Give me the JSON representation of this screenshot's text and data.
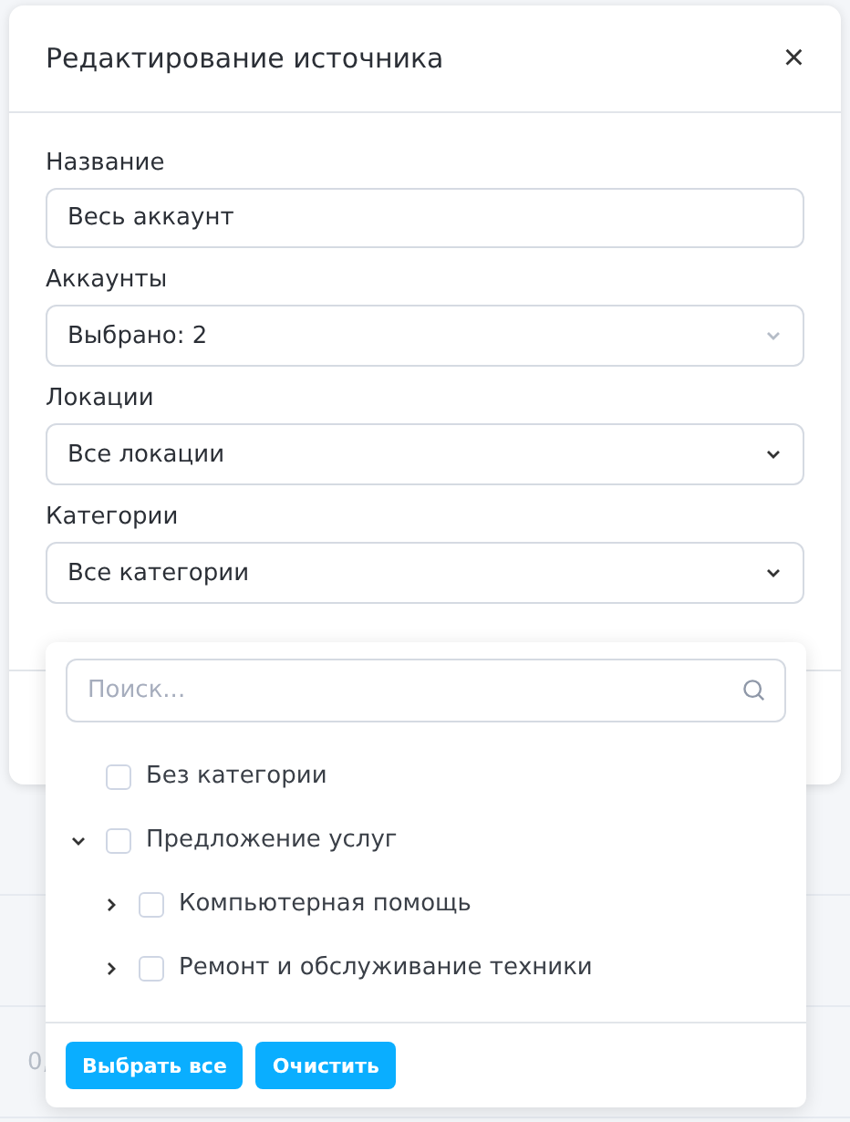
{
  "background": {
    "cell_text": "0,"
  },
  "dialog": {
    "title": "Редактирование источника",
    "close": "×"
  },
  "fields": [
    {
      "kind": "text",
      "label": "Название",
      "value": "Весь аккаунт"
    },
    {
      "kind": "select",
      "label": "Аккаунты",
      "value": "Выбрано: 2",
      "disabled": true
    },
    {
      "kind": "select",
      "label": "Локации",
      "value": "Все локации",
      "disabled": false
    },
    {
      "kind": "select",
      "label": "Категории",
      "value": "Все категории",
      "disabled": false
    }
  ],
  "dropdown": {
    "search": {
      "placeholder": "Поиск..."
    },
    "tree": [
      {
        "label": "Без категории",
        "checked": false
      },
      {
        "label": "Предложение услуг",
        "checked": false,
        "expanded": true,
        "children": [
          {
            "label": "Компьютерная помощь",
            "checked": false,
            "expanded": false
          },
          {
            "label": "Ремонт и обслуживание техники",
            "checked": false,
            "expanded": false
          }
        ]
      }
    ],
    "buttons": [
      "Выбрать все",
      "Очистить"
    ]
  }
}
